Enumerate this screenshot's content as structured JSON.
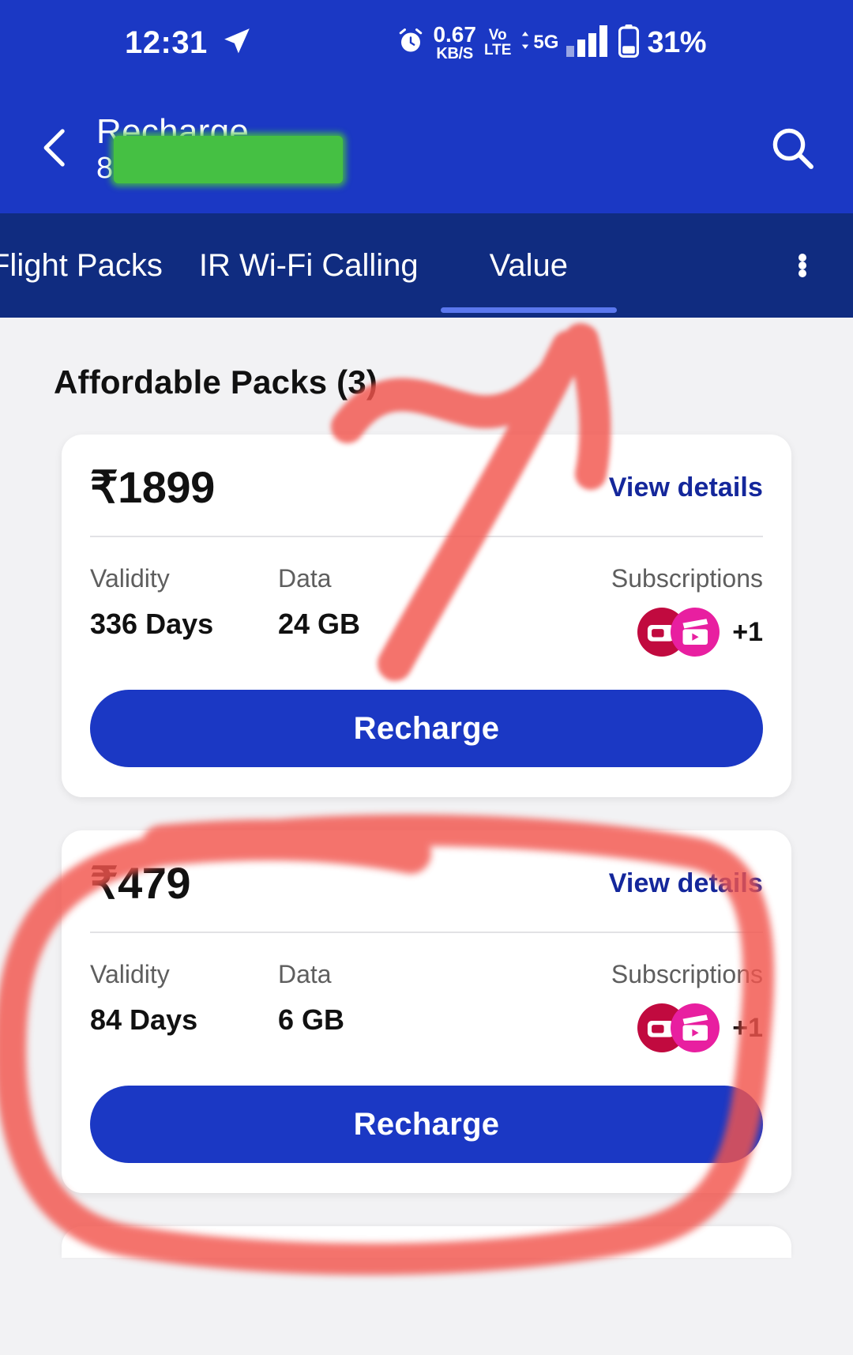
{
  "status_bar": {
    "time": "12:31",
    "location_icon": "navigation-icon",
    "alarm_icon": "alarm-clock-icon",
    "net_speed_value": "0.67",
    "net_speed_unit": "KB/S",
    "volte_line1": "Vo",
    "volte_line2": "LTE",
    "network_type": "5G",
    "battery_percent": "31%"
  },
  "app_bar": {
    "back_icon": "back-chevron-icon",
    "title": "Recharge",
    "subtitle": "8",
    "search_icon": "search-icon"
  },
  "tabs": {
    "items": [
      {
        "label": "Flight Packs",
        "active": false
      },
      {
        "label": "IR Wi-Fi Calling",
        "active": false
      },
      {
        "label": "Value",
        "active": true
      }
    ],
    "overflow_icon": "kebab-menu-icon",
    "active_indicator_color": "#5b78ee"
  },
  "main": {
    "section_title": "Affordable Packs (3)",
    "labels": {
      "validity": "Validity",
      "data": "Data",
      "subscriptions": "Subscriptions"
    },
    "view_details_label": "View details",
    "recharge_label": "Recharge",
    "packs": [
      {
        "price": "₹1899",
        "validity": "336 Days",
        "data": "24 GB",
        "subs_extra": "+1",
        "sub_icons": [
          "jiotv-icon",
          "jiocinema-icon"
        ]
      },
      {
        "price": "₹479",
        "validity": "84 Days",
        "data": "6 GB",
        "subs_extra": "+1",
        "sub_icons": [
          "jiotv-icon",
          "jiocinema-icon"
        ]
      }
    ]
  },
  "annotations": {
    "arrow_color": "#f2554e",
    "circle_color": "#f2554e",
    "redaction_color": "#45c043",
    "arrow_target": "Value",
    "circled_pack": "₹479"
  },
  "theme": {
    "primary_blue": "#1B38C4",
    "tabbar_navy": "#102C80",
    "page_bg": "#f2f2f4",
    "link_blue": "#14279B",
    "card_white": "#ffffff"
  }
}
